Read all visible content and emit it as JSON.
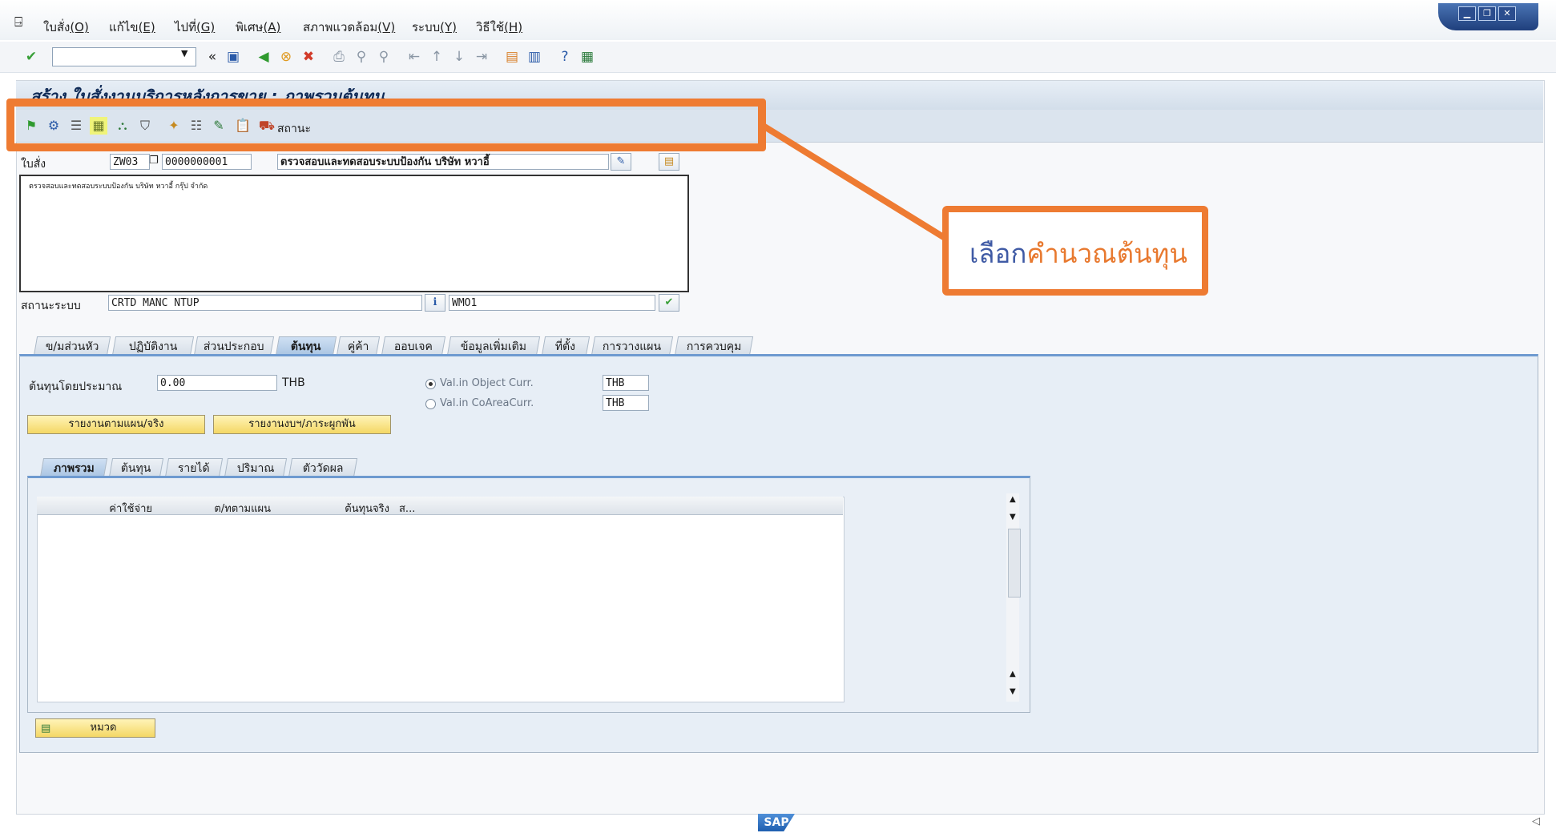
{
  "menu": [
    {
      "name": "menu-order",
      "label": "ใบสั่ง",
      "key": "(O)"
    },
    {
      "name": "menu-edit",
      "label": "แก้ไข",
      "key": "(E)"
    },
    {
      "name": "menu-goto",
      "label": "ไปที่",
      "key": "(G)"
    },
    {
      "name": "menu-extras",
      "label": "พิเศษ",
      "key": "(A)"
    },
    {
      "name": "menu-environment",
      "label": "สภาพแวดล้อม",
      "key": "(V)"
    },
    {
      "name": "menu-system",
      "label": "ระบบ",
      "key": "(Y)"
    },
    {
      "name": "menu-help",
      "label": "วิธีใช้",
      "key": "(H)"
    }
  ],
  "title": "สร้าง ใบสั่งงานบริการหลังการขาย : ภาพรวมต้นทุน",
  "app_toolbar": {
    "status_label": "สถานะ"
  },
  "header": {
    "order_label": "ใบสั่ง",
    "order_type": "ZW03",
    "order_number": "0000000001",
    "order_short_text": "ตรวจสอบและทดสอบระบบป้องกัน บริษัท หวาอี้",
    "long_text": "ตรวจสอบและทดสอบระบบป้องกัน บริษัท หวาอี้ กรุ๊ป จำกัด",
    "sys_status_label": "สถานะระบบ",
    "sys_status_value": "CRTD MANC NTUP",
    "user_status_value": "WMO1"
  },
  "tabs": [
    {
      "label": "ข/มส่วนหัว",
      "active": false
    },
    {
      "label": "ปฏิบัติงาน",
      "active": false
    },
    {
      "label": "ส่วนประกอบ",
      "active": false
    },
    {
      "label": "ต้นทุน",
      "active": true
    },
    {
      "label": "คู่ค้า",
      "active": false
    },
    {
      "label": "ออบเจค",
      "active": false
    },
    {
      "label": "ข้อมูลเพิ่มเติม",
      "active": false
    },
    {
      "label": "ที่ตั้ง",
      "active": false
    },
    {
      "label": "การวางแผน",
      "active": false
    },
    {
      "label": "การควบคุม",
      "active": false
    }
  ],
  "costs": {
    "estimated_label": "ต้นทุนโดยประมาณ",
    "estimated_value": "0.00",
    "currency": "THB",
    "radio_object_curr": "Val.in Object Curr.",
    "radio_object_value": "THB",
    "radio_coarea_curr": "Val.in CoAreaCurr.",
    "radio_coarea_value": "THB",
    "btn_plan_actual": "รายงานตามแผน/จริง",
    "btn_budget": "รายงานงบฯ/ภาระผูกพัน"
  },
  "subtabs": [
    {
      "label": "ภาพรวม",
      "active": true
    },
    {
      "label": "ต้นทุน",
      "active": false
    },
    {
      "label": "รายได้",
      "active": false
    },
    {
      "label": "ปริมาณ",
      "active": false
    },
    {
      "label": "ตัววัดผล",
      "active": false
    }
  ],
  "grid_columns": [
    "ค่าใช้จ่าย",
    "ต/ทตามแผน",
    "ต้นทุนจริง",
    "ส..."
  ],
  "category_button": "หมวด",
  "callout": {
    "prefix": "เลือก",
    "highlight": "คำนวณต้นทุน"
  },
  "logo_text": "SAP",
  "colors": {
    "highlight": "#ee7b32",
    "callout_text": "#3f5aa5",
    "active_tab": "#a9c4e2"
  }
}
